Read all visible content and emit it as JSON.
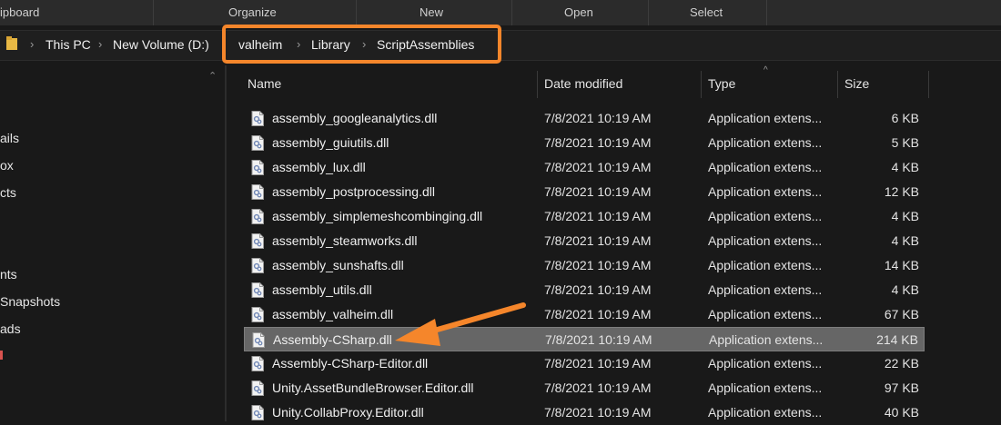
{
  "ribbon": {
    "groups": [
      "ipboard",
      "Organize",
      "New",
      "Open",
      "Select"
    ]
  },
  "address": {
    "crumbs": [
      "This PC",
      "New Volume (D:)",
      "valheim",
      "Library",
      "ScriptAssemblies"
    ]
  },
  "nav": {
    "items": [
      "ails",
      "ox",
      "cts",
      "nts",
      "Snapshots",
      "ads"
    ]
  },
  "columns": {
    "name": "Name",
    "date": "Date modified",
    "type": "Type",
    "size": "Size"
  },
  "files": [
    {
      "name": "assembly_googleanalytics.dll",
      "date": "7/8/2021 10:19 AM",
      "type": "Application extens...",
      "size": "6 KB"
    },
    {
      "name": "assembly_guiutils.dll",
      "date": "7/8/2021 10:19 AM",
      "type": "Application extens...",
      "size": "5 KB"
    },
    {
      "name": "assembly_lux.dll",
      "date": "7/8/2021 10:19 AM",
      "type": "Application extens...",
      "size": "4 KB"
    },
    {
      "name": "assembly_postprocessing.dll",
      "date": "7/8/2021 10:19 AM",
      "type": "Application extens...",
      "size": "12 KB"
    },
    {
      "name": "assembly_simplemeshcombinging.dll",
      "date": "7/8/2021 10:19 AM",
      "type": "Application extens...",
      "size": "4 KB"
    },
    {
      "name": "assembly_steamworks.dll",
      "date": "7/8/2021 10:19 AM",
      "type": "Application extens...",
      "size": "4 KB"
    },
    {
      "name": "assembly_sunshafts.dll",
      "date": "7/8/2021 10:19 AM",
      "type": "Application extens...",
      "size": "14 KB"
    },
    {
      "name": "assembly_utils.dll",
      "date": "7/8/2021 10:19 AM",
      "type": "Application extens...",
      "size": "4 KB"
    },
    {
      "name": "assembly_valheim.dll",
      "date": "7/8/2021 10:19 AM",
      "type": "Application extens...",
      "size": "67 KB"
    },
    {
      "name": "Assembly-CSharp.dll",
      "date": "7/8/2021 10:19 AM",
      "type": "Application extens...",
      "size": "214 KB"
    },
    {
      "name": "Assembly-CSharp-Editor.dll",
      "date": "7/8/2021 10:19 AM",
      "type": "Application extens...",
      "size": "22 KB"
    },
    {
      "name": "Unity.AssetBundleBrowser.Editor.dll",
      "date": "7/8/2021 10:19 AM",
      "type": "Application extens...",
      "size": "97 KB"
    },
    {
      "name": "Unity.CollabProxy.Editor.dll",
      "date": "7/8/2021 10:19 AM",
      "type": "Application extens...",
      "size": "40 KB"
    }
  ],
  "selected_file": "Assembly-CSharp.dll",
  "colors": {
    "annotation": "#f5862b",
    "selection": "#666666",
    "background": "#191919"
  },
  "icons": [
    "folder-icon",
    "dll-file-icon",
    "chevron-right-icon",
    "scroll-up-icon",
    "sort-caret-icon"
  ]
}
